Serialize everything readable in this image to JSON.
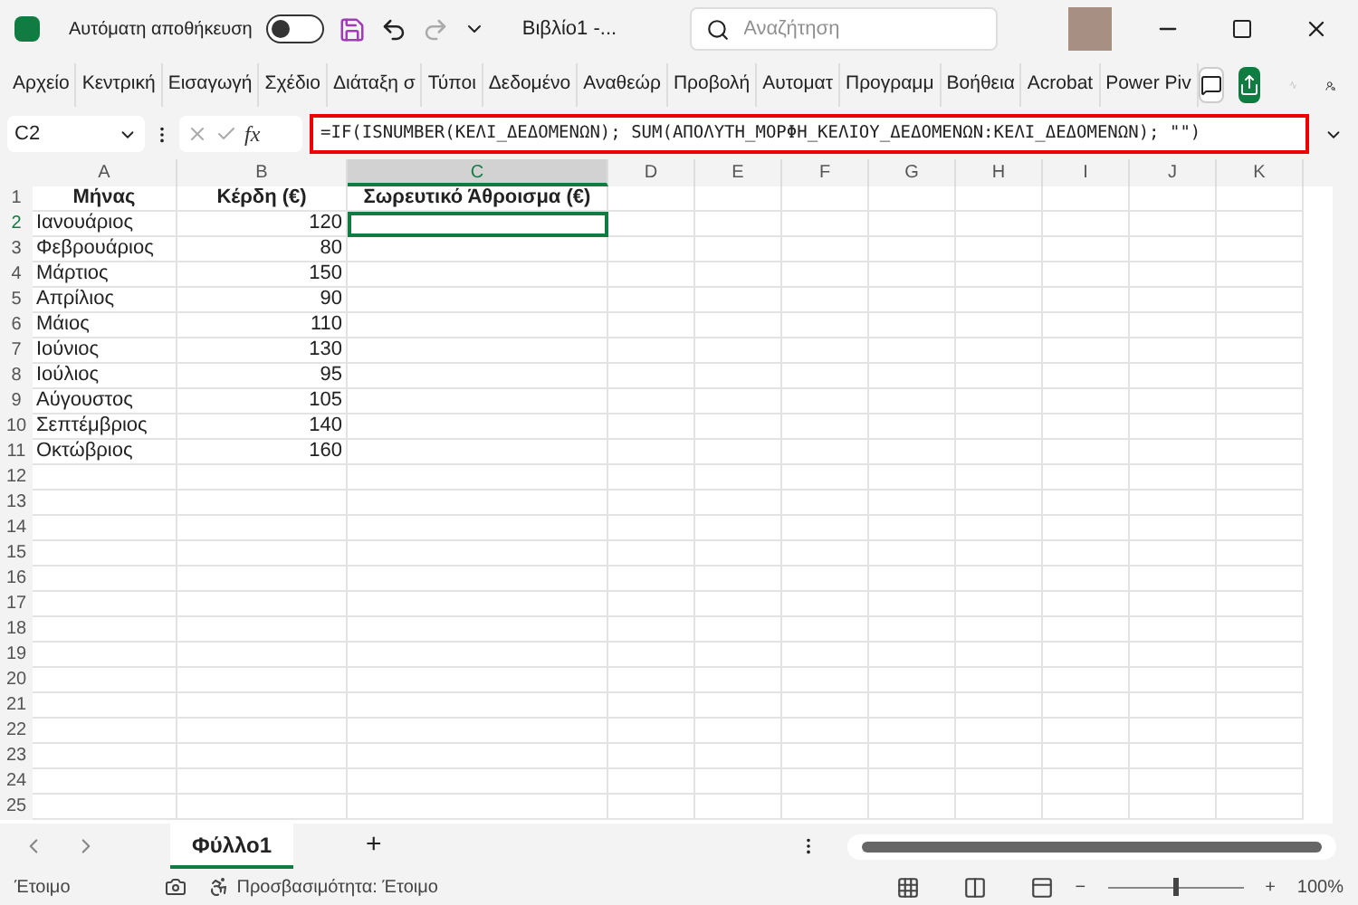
{
  "title_bar": {
    "autosave_label": "Αυτόματη αποθήκευση",
    "autosave_on": false,
    "file_name": "Βιβλίο1 -...",
    "search_placeholder": "Αναζήτηση"
  },
  "ribbon_tabs": [
    {
      "label": "Αρχείο",
      "selected": false
    },
    {
      "label": "Κεντρική",
      "selected": false
    },
    {
      "label": "Εισαγωγή",
      "selected": false
    },
    {
      "label": "Σχέδιο",
      "selected": false
    },
    {
      "label": "Διάταξη σ",
      "selected": false
    },
    {
      "label": "Τύποι",
      "selected": false
    },
    {
      "label": "Δεδομένο",
      "selected": false
    },
    {
      "label": "Αναθεώρ",
      "selected": false
    },
    {
      "label": "Προβολή",
      "selected": false
    },
    {
      "label": "Αυτοματ",
      "selected": false
    },
    {
      "label": "Προγραμμ",
      "selected": false
    },
    {
      "label": "Βοήθεια",
      "selected": false
    },
    {
      "label": "Acrobat",
      "selected": false
    },
    {
      "label": "Power Piv",
      "selected": false
    }
  ],
  "formula_bar": {
    "name_box": "C2",
    "fx": "fx",
    "formula": "=IF(ISNUMBER(ΚΕΛΙ_ΔΕΔΟΜΕΝΩΝ); SUM(ΑΠΟΛΥΤΗ_ΜΟΡΦΗ_ΚΕΛΙΟΥ_ΔΕΔΟΜΕΝΩΝ:ΚΕΛΙ_ΔΕΔΟΜΕΝΩΝ); \"\")"
  },
  "columns": [
    {
      "label": "A",
      "selected": false
    },
    {
      "label": "B",
      "selected": false
    },
    {
      "label": "C",
      "selected": true
    },
    {
      "label": "D",
      "selected": false
    },
    {
      "label": "E",
      "selected": false
    },
    {
      "label": "F",
      "selected": false
    },
    {
      "label": "G",
      "selected": false
    },
    {
      "label": "H",
      "selected": false
    },
    {
      "label": "I",
      "selected": false
    },
    {
      "label": "J",
      "selected": false
    },
    {
      "label": "K",
      "selected": false
    }
  ],
  "rows": [
    {
      "number": "1",
      "cells": [
        "Μήνας",
        "Κέρδη (€)",
        "Σωρευτικό Άθροισμα (€)"
      ],
      "kind": "header"
    },
    {
      "number": "2",
      "cells": [
        "Ιανουάριος",
        "120"
      ],
      "kind": "data",
      "selected": true
    },
    {
      "number": "3",
      "cells": [
        "Φεβρουάριος",
        "80"
      ],
      "kind": "data"
    },
    {
      "number": "4",
      "cells": [
        "Μάρτιος",
        "150"
      ],
      "kind": "data"
    },
    {
      "number": "5",
      "cells": [
        "Απρίλιος",
        "90"
      ],
      "kind": "data"
    },
    {
      "number": "6",
      "cells": [
        "Μάιος",
        "110"
      ],
      "kind": "data"
    },
    {
      "number": "7",
      "cells": [
        "Ιούνιος",
        "130"
      ],
      "kind": "data"
    },
    {
      "number": "8",
      "cells": [
        "Ιούλιος",
        "95"
      ],
      "kind": "data"
    },
    {
      "number": "9",
      "cells": [
        "Αύγουστος",
        "105"
      ],
      "kind": "data"
    },
    {
      "number": "10",
      "cells": [
        "Σεπτέμβριος",
        "140"
      ],
      "kind": "data"
    },
    {
      "number": "11",
      "cells": [
        "Οκτώβριος",
        "160"
      ],
      "kind": "data"
    },
    {
      "number": "12",
      "cells": [],
      "kind": "data"
    },
    {
      "number": "13",
      "cells": [],
      "kind": "data"
    },
    {
      "number": "14",
      "cells": [],
      "kind": "data"
    },
    {
      "number": "15",
      "cells": [],
      "kind": "data"
    },
    {
      "number": "16",
      "cells": [],
      "kind": "data"
    },
    {
      "number": "17",
      "cells": [],
      "kind": "data"
    },
    {
      "number": "18",
      "cells": [],
      "kind": "data"
    },
    {
      "number": "19",
      "cells": [],
      "kind": "data"
    },
    {
      "number": "20",
      "cells": [],
      "kind": "data"
    },
    {
      "number": "21",
      "cells": [],
      "kind": "data"
    },
    {
      "number": "22",
      "cells": [],
      "kind": "data"
    },
    {
      "number": "23",
      "cells": [],
      "kind": "data"
    },
    {
      "number": "24",
      "cells": [],
      "kind": "data"
    },
    {
      "number": "25",
      "cells": [],
      "kind": "data"
    }
  ],
  "sheet_tabs": [
    {
      "label": "Φύλλο1",
      "selected": true
    }
  ],
  "add_sheet": "+",
  "status_bar": {
    "ready": "Έτοιμο",
    "accessibility": "Προσβασιμότητα: Έτοιμο",
    "level": 0.5,
    "zoom": "100%",
    "zoom_minus": "−",
    "zoom_plus": "+"
  }
}
